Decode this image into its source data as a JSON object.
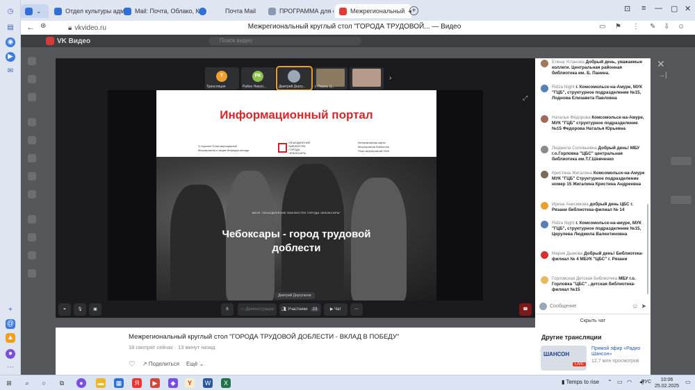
{
  "browser": {
    "tabs": [
      {
        "label": "Отдел культуры админ",
        "color": "#2f6fd6"
      },
      {
        "label": "Mail: Почта, Облако, Кале",
        "color": "#2f6fd6"
      },
      {
        "label": "Почта Mail",
        "color": "#2f6fd6"
      },
      {
        "label": "ПРОГРАММА для служ",
        "color": "#8a98b0"
      },
      {
        "label": "Межрегиональный",
        "color": "#e53935",
        "active": true
      }
    ],
    "url": "vkvideo.ru",
    "page_title": "Межрегиональный круглый стол \"ГОРОДА ТРУДОВОЙ... — Видео"
  },
  "vk": {
    "logo_text": "VK Видео",
    "search_placeholder": "Поиск видео"
  },
  "participants": [
    {
      "initials": "Т",
      "name": "Трансляция",
      "color": "#f0a030",
      "photo": false
    },
    {
      "initials": "РК",
      "name": "Район Никол...",
      "color": "#8bc34a",
      "photo": false
    },
    {
      "initials": "",
      "name": "Дмитрий Дергу...",
      "color": "#9aa8b5",
      "photo": true
    },
    {
      "initials": "",
      "name": "г. Пермь Ц...",
      "color": "#8a7a60",
      "photo": true
    },
    {
      "initials": "",
      "name": "",
      "color": "#b79a8a",
      "photo": true
    }
  ],
  "slide": {
    "title": "Информационный портал",
    "links_left": [
      "О портале     План мероприятий",
      "Мероприятия и акции      Инфорум-storage"
    ],
    "logo_text": [
      "ОБЪЕДИНЕНИЕ",
      "БИБЛИОТЕК",
      "ГОРОДА ЧЕБОКСАРЫ"
    ],
    "links_right": [
      "Интерактивная карта",
      "Мероприятия библиотек",
      "План мероприятий 2024"
    ],
    "small_caption": "МБУК \"ОБЪЕДИНЕНИЕ БИБЛИОТЕК ГОРОДА ЧЕБОКСАРЫ\"",
    "headline": "Чебоксары - город трудовой доблести"
  },
  "speaker_tag": "Дмитрий Дергуганов",
  "controls": {
    "participants_label": "Участники",
    "participants_count": "23",
    "chat_label": "Чат",
    "screen_label": "Демонстрация"
  },
  "chat": {
    "messages": [
      {
        "author": "Елена Угланова",
        "text": "Добрый день, уважаемые коллеги. Центральная районная библиотека им. Б. Панина.",
        "color": "#a07860"
      },
      {
        "author": "Ridza Night",
        "text": "г. Комсомольск-на-Амуре, МУК \"ГЦБ\", структурное подразделение №15, Лоднова Елизавета Павловна",
        "color": "#5a7fb5"
      },
      {
        "author": "Наталья Фёдорова",
        "text": "Комсомольск-на-Амуре, МУК \"ГЦБ\" структурное подразделение №15 Федорова Наталья Юрьевна",
        "color": "#a06a5a"
      },
      {
        "author": "Людмила Соловьевна",
        "text": "Добрый день! МБУ г.о.Горловка \"ЦБС\" центральная библиотека им.Т.Г.Шевченко",
        "color": "#8a8a8a"
      },
      {
        "author": "Кристина Жигалина",
        "text": "Комсомольск-на-Амуре МУК \"ГЦБ\" Структурное подразделение номер 15 Жигалина Кристина Андреевна",
        "color": "#7a6a5a"
      },
      {
        "author": "Ирина Анисимова",
        "text": "добрый день ЦБС г. Рязани библиотека-филиал № 14",
        "color": "#e8a030"
      },
      {
        "author": "Ridza Night",
        "text": "г. Комсомольск-на-амуре, МУК \"ГЦБ\", структурное подразделение №15, Церулева Людмила Валентиновна",
        "color": "#5a7fb5"
      },
      {
        "author": "Мария Дымова",
        "text": "Добрый день! Библиотека-филиал № 4 МБУК \"ЦБС\" г. Рязани",
        "color": "#d63030"
      },
      {
        "author": "Горловская Детская Библиотека",
        "text": "МБУ г.о. Горловка \"ЦБС\" , детская библиотека-филиал №15",
        "color": "#e8b860"
      }
    ],
    "input_placeholder": "Сообщение",
    "hide_chat": "Скрыть чат"
  },
  "video": {
    "title": "Межрегиональный круглый стол \"ГОРОДА ТРУДОВОЙ ДОБЛЕСТИ - ВКЛАД В ПОБЕДУ\"",
    "meta": "18 смотрят сейчас · 13 минут назад",
    "share": "Поделиться",
    "more": "Ещё"
  },
  "other": {
    "heading": "Другие трансляции",
    "item_title": "Прямой эфир «Радио Шансон»",
    "item_views": "12,7 млн просмотров",
    "live": "LIVE",
    "thumb_label": "ШАНСОН"
  },
  "taskbar": {
    "weather": "Temps to rise",
    "lang": "РУС",
    "time": "10:06",
    "date": "25.02.2025"
  }
}
